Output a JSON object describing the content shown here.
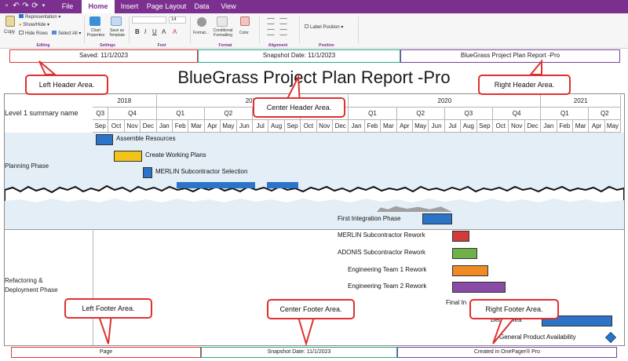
{
  "ribbon": {
    "tabs": [
      "File",
      "Home",
      "Insert",
      "Page Layout",
      "Data",
      "View"
    ],
    "active_tab": "Home",
    "copy": "Copy",
    "representation": "Representation",
    "show_hide": "Show/Hide",
    "hide_rows": "Hide Rows",
    "select_all": "Select All",
    "chart_properties": "Chart Properties",
    "save_as_template": "Save as Template",
    "format": "Format...",
    "conditional_formatting": "Conditional Formatting",
    "color": "Color",
    "label_position": "Label Position",
    "font_size": "14",
    "groups": {
      "editing": "Editing",
      "settings": "Settings",
      "font": "Font",
      "format": "Format",
      "alignment": "Alignment",
      "position": "Position"
    }
  },
  "header": {
    "left": "Saved: 11/1/2023",
    "center": "Snapshot Date: 11/1/2023",
    "right": "BlueGrass Project Plan Report -Pro",
    "title": "BlueGrass Project Plan Report -Pro",
    "colors": {
      "left": "#e03a3a",
      "center": "#2aa68c",
      "right": "#7b3f9e"
    }
  },
  "timeline": {
    "row_header": "Level 1 summary name",
    "years": [
      "2018",
      "2019",
      "2020",
      "2021"
    ],
    "quarters": [
      "Q3",
      "Q4",
      "Q1",
      "Q2",
      "Q3",
      "Q4",
      "Q1",
      "Q2",
      "Q3",
      "Q4",
      "Q1",
      "Q2"
    ],
    "months": [
      "Sep",
      "Oct",
      "Nov",
      "Dec",
      "Jan",
      "Feb",
      "Mar",
      "Apr",
      "May",
      "Jun",
      "Jul",
      "Aug",
      "Sep",
      "Oct",
      "Nov",
      "Dec",
      "Jan",
      "Feb",
      "Mar",
      "Apr",
      "May",
      "Jun",
      "Jul",
      "Aug",
      "Sep",
      "Oct",
      "Nov",
      "Dec",
      "Jan",
      "Feb",
      "Mar",
      "Apr",
      "May"
    ]
  },
  "rows": {
    "planning": "Planning Phase",
    "refactoring": "Refactoring &\nDeployment Phase"
  },
  "tasks": {
    "assemble": "Assemble Resources",
    "working_plans": "Create Working Plans",
    "merlin_sel": "MERLIN Subcontractor Selection",
    "first_integration": "First Integration Phase",
    "merlin_rework": "MERLIN Subcontractor Rework",
    "adonis_rework": "ADONIS Subcontractor Rework",
    "eng1_rework": "Engineering Team 1 Rework",
    "eng2_rework": "Engineering Team 2 Rework",
    "final_int": "Final In",
    "beta_release": "Beta Relea",
    "general_avail": "General Product Availability"
  },
  "callouts": {
    "left_header": "Left Header Area.",
    "center_header": "Center Header Area.",
    "right_header": "Right Header Area.",
    "left_footer": "Left Footer Area.",
    "center_footer": "Center Footer Area.",
    "right_footer": "Right Footer Area."
  },
  "footer": {
    "left": "Page",
    "center": "Snapshot Date: 11/1/2023",
    "right": "Created in OnePager® Pro"
  },
  "colors": {
    "brand": "#7b2f8e",
    "band": "#e3eef7",
    "bar_blue": "#2b74c7",
    "bar_gray": "#6b6b6b",
    "bar_yellow": "#f0c419",
    "bar_red": "#d23b3b",
    "bar_green": "#6fb04a",
    "bar_orange": "#f08a24",
    "bar_purple": "#8a4aa8"
  }
}
